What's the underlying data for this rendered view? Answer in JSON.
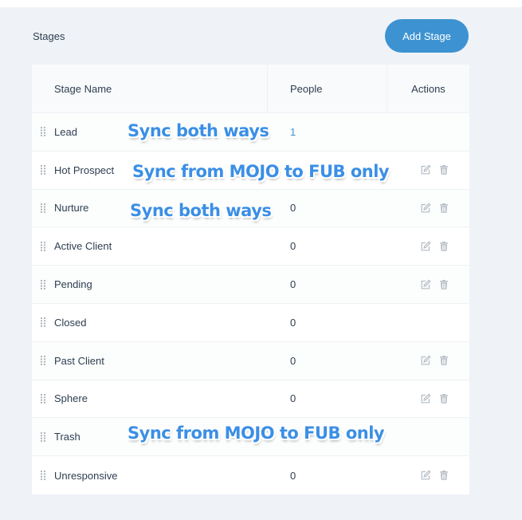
{
  "page": {
    "heading": "Stages",
    "add_button": "Add Stage"
  },
  "table": {
    "headers": {
      "name": "Stage Name",
      "people": "People",
      "actions": "Actions"
    },
    "rows": [
      {
        "name": "Lead",
        "people": "1",
        "editable": false
      },
      {
        "name": "Hot Prospect",
        "people": "0",
        "editable": true
      },
      {
        "name": "Nurture",
        "people": "0",
        "editable": true
      },
      {
        "name": "Active Client",
        "people": "0",
        "editable": true
      },
      {
        "name": "Pending",
        "people": "0",
        "editable": true
      },
      {
        "name": "Closed",
        "people": "0",
        "editable": false
      },
      {
        "name": "Past Client",
        "people": "0",
        "editable": true
      },
      {
        "name": "Sphere",
        "people": "0",
        "editable": true
      },
      {
        "name": "Trash",
        "people": "",
        "editable": false
      },
      {
        "name": "Unresponsive",
        "people": "0",
        "editable": true
      }
    ]
  },
  "annotations": [
    {
      "text": "Sync both ways",
      "row": "Lead"
    },
    {
      "text": "Sync from MOJO to FUB only",
      "row": "Hot Prospect"
    },
    {
      "text": "Sync both ways",
      "row": "Nurture"
    },
    {
      "text": "Sync from MOJO to FUB only",
      "row": "Trash"
    }
  ],
  "icons": {
    "drag": "drag-handle-icon",
    "edit": "edit-icon",
    "delete": "trash-icon"
  },
  "colors": {
    "background": "#eff2f7",
    "accent": "#3d93d1",
    "annotation": "#3b8fe6",
    "icon": "#b4bcc4"
  }
}
